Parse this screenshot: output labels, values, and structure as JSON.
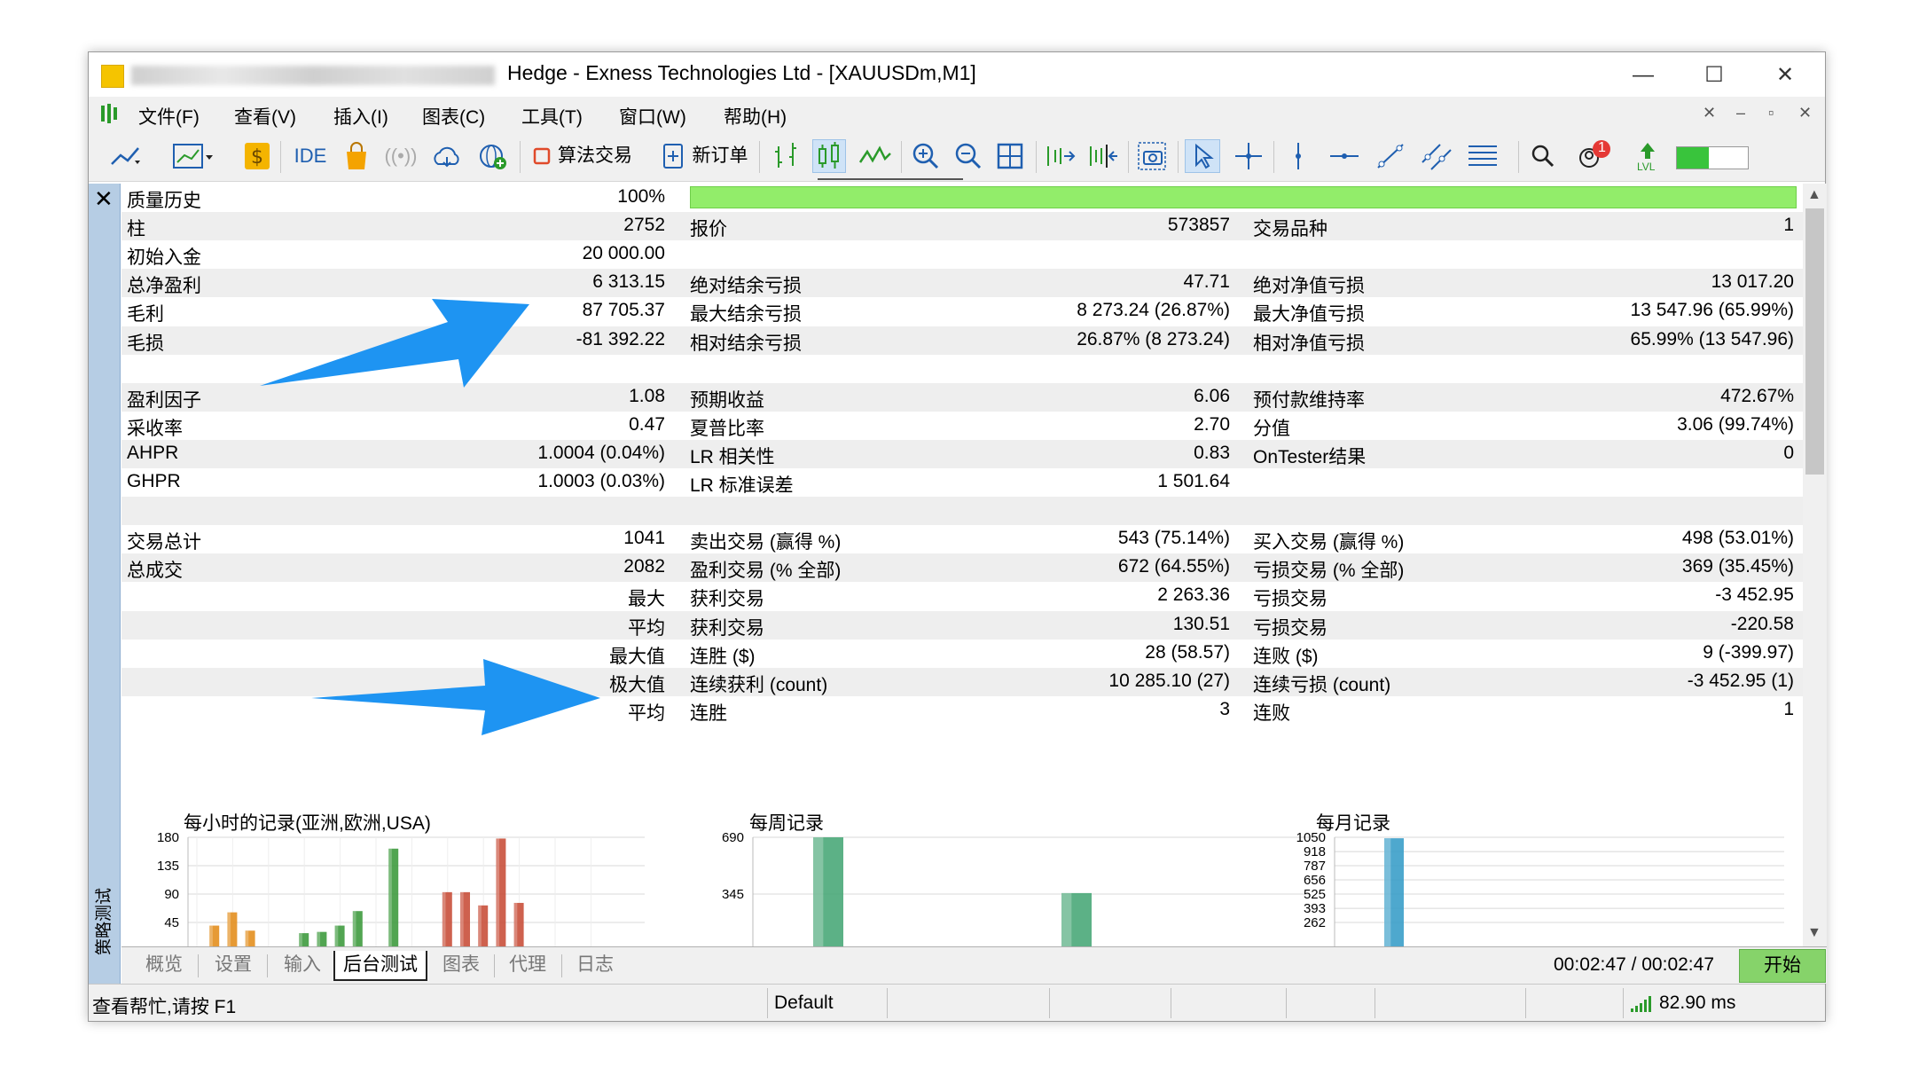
{
  "window": {
    "title": "Hedge - Exness Technologies Ltd - [XAUUSDm,M1]",
    "minimize": "—",
    "maximize": "☐",
    "close": "✕"
  },
  "menu": [
    "文件(F)",
    "查看(V)",
    "插入(I)",
    "图表(C)",
    "工具(T)",
    "窗口(W)",
    "帮助(H)"
  ],
  "toolbar": {
    "ide": "IDE",
    "algo_trading": "算法交易",
    "new_order": "新订单",
    "notification_count": "1",
    "lvl": "LVL"
  },
  "report": {
    "quality_label": "质量历史",
    "quality_value": "100%",
    "quality_fill": 1.0,
    "rows": [
      {
        "l1": "柱",
        "v1": "2752",
        "l2": "报价",
        "v2": "573857",
        "l3": "交易品种",
        "v3": "1"
      },
      {
        "l1": "初始入金",
        "v1": "20 000.00",
        "l2": "",
        "v2": "",
        "l3": "",
        "v3": ""
      },
      {
        "l1": "总净盈利",
        "v1": "6 313.15",
        "l2": "绝对结余亏损",
        "v2": "47.71",
        "l3": "绝对净值亏损",
        "v3": "13 017.20"
      },
      {
        "l1": "毛利",
        "v1": "87 705.37",
        "l2": "最大结余亏损",
        "v2": "8 273.24 (26.87%)",
        "l3": "最大净值亏损",
        "v3": "13 547.96 (65.99%)"
      },
      {
        "l1": "毛损",
        "v1": "-81 392.22",
        "l2": "相对结余亏损",
        "v2": "26.87% (8 273.24)",
        "l3": "相对净值亏损",
        "v3": "65.99% (13 547.96)"
      },
      {
        "l1": "",
        "v1": "",
        "l2": "",
        "v2": "",
        "l3": "",
        "v3": ""
      },
      {
        "l1": "盈利因子",
        "v1": "1.08",
        "l2": "预期收益",
        "v2": "6.06",
        "l3": "预付款维持率",
        "v3": "472.67%"
      },
      {
        "l1": "采收率",
        "v1": "0.47",
        "l2": "夏普比率",
        "v2": "2.70",
        "l3": "分值",
        "v3": "3.06 (99.74%)"
      },
      {
        "l1": "AHPR",
        "v1": "1.0004 (0.04%)",
        "l2": "LR 相关性",
        "v2": "0.83",
        "l3": "OnTester结果",
        "v3": "0"
      },
      {
        "l1": "GHPR",
        "v1": "1.0003 (0.03%)",
        "l2": "LR 标准误差",
        "v2": "1 501.64",
        "l3": "",
        "v3": ""
      },
      {
        "l1": "",
        "v1": "",
        "l2": "",
        "v2": "",
        "l3": "",
        "v3": ""
      },
      {
        "l1": "交易总计",
        "v1": "1041",
        "l2": "卖出交易 (赢得 %)",
        "v2": "543 (75.14%)",
        "l3": "买入交易 (赢得 %)",
        "v3": "498 (53.01%)"
      },
      {
        "l1": "总成交",
        "v1": "2082",
        "l2": "盈利交易 (% 全部)",
        "v2": "672 (64.55%)",
        "l3": "亏损交易 (% 全部)",
        "v3": "369 (35.45%)"
      },
      {
        "l1": "",
        "v1": "最大",
        "l2": "获利交易",
        "v2": "2 263.36",
        "l3": "亏损交易",
        "v3": "-3 452.95"
      },
      {
        "l1": "",
        "v1": "平均",
        "l2": "获利交易",
        "v2": "130.51",
        "l3": "亏损交易",
        "v3": "-220.58"
      },
      {
        "l1": "",
        "v1": "最大值",
        "l2": "连胜 ($)",
        "v2": "28 (58.57)",
        "l3": "连败 ($)",
        "v3": "9 (-399.97)"
      },
      {
        "l1": "",
        "v1": "极大值",
        "l2": "连续获利 (count)",
        "v2": "10 285.10 (27)",
        "l3": "连续亏损 (count)",
        "v3": "-3 452.95 (1)"
      },
      {
        "l1": "",
        "v1": "平均",
        "l2": "连胜",
        "v2": "3",
        "l3": "连败",
        "v3": "1"
      }
    ]
  },
  "chart_data": [
    {
      "type": "bar",
      "title": "每小时的记录(亚洲,欧洲,USA)",
      "ylim": [
        0,
        180
      ],
      "yticks": [
        "180",
        "135",
        "90",
        "45"
      ],
      "series": [
        {
          "values": [
            0,
            0,
            0,
            0,
            0,
            0,
            0,
            0,
            0,
            0,
            0,
            0,
            0,
            0,
            0,
            0,
            0,
            0,
            0,
            0,
            0,
            0,
            0,
            0
          ]
        }
      ],
      "bars": [
        {
          "hour": 1,
          "value": 40,
          "color": "#e38f1f"
        },
        {
          "hour": 2,
          "value": 61,
          "color": "#e38f1f"
        },
        {
          "hour": 3,
          "value": 32,
          "color": "#e38f1f"
        },
        {
          "hour": 6,
          "value": 28,
          "color": "#3f9b3f"
        },
        {
          "hour": 7,
          "value": 30,
          "color": "#3f9b3f"
        },
        {
          "hour": 8,
          "value": 40,
          "color": "#3f9b3f"
        },
        {
          "hour": 9,
          "value": 63,
          "color": "#3f9b3f"
        },
        {
          "hour": 11,
          "value": 162,
          "color": "#3f9b3f"
        },
        {
          "hour": 14,
          "value": 93,
          "color": "#c9503b"
        },
        {
          "hour": 15,
          "value": 93,
          "color": "#c9503b"
        },
        {
          "hour": 16,
          "value": 72,
          "color": "#c9503b"
        },
        {
          "hour": 17,
          "value": 178,
          "color": "#c9503b"
        },
        {
          "hour": 18,
          "value": 76,
          "color": "#c9503b"
        }
      ]
    },
    {
      "type": "bar",
      "title": "每周记录",
      "ylim": [
        0,
        690
      ],
      "yticks": [
        "690",
        "345"
      ],
      "bars": [
        {
          "slot": 0,
          "value": 690,
          "color": "#4aa879"
        },
        {
          "slot": 2,
          "value": 351,
          "color": "#4aa879"
        }
      ]
    },
    {
      "type": "bar",
      "title": "每月记录",
      "ylim": [
        0,
        1050
      ],
      "yticks": [
        "1050",
        "918",
        "787",
        "656",
        "525",
        "393",
        "262"
      ],
      "bars": [
        {
          "slot": 0,
          "value": 1041,
          "color": "#3b9fc9"
        }
      ]
    }
  ],
  "tabs": [
    "概览",
    "设置",
    "输入",
    "后台测试",
    "图表",
    "代理",
    "日志"
  ],
  "active_tab": "后台测试",
  "side_label": "策略测试",
  "timer": "00:02:47 / 00:02:47",
  "start_button": "开始",
  "status": {
    "help": "查看帮忙,请按 F1",
    "profile": "Default",
    "ping": "82.90 ms"
  }
}
